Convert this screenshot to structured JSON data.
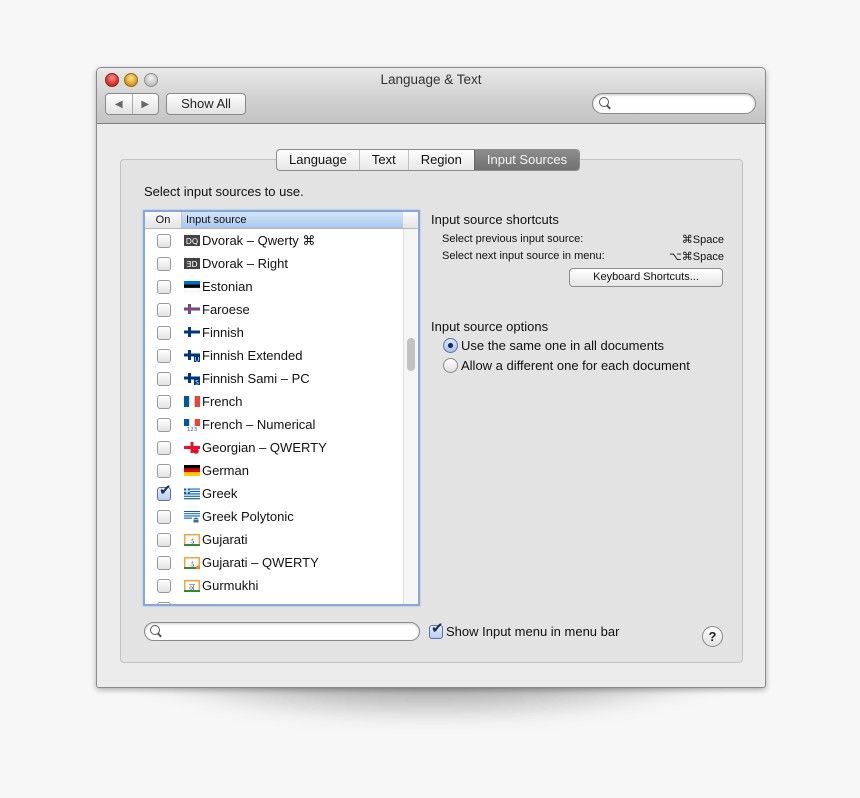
{
  "window": {
    "title": "Language & Text",
    "nav": {
      "back_icon": "◀",
      "forward_icon": "▶"
    },
    "show_all_label": "Show All",
    "search": {
      "value": "",
      "placeholder": ""
    }
  },
  "tabs": [
    {
      "label": "Language",
      "active": false
    },
    {
      "label": "Text",
      "active": false
    },
    {
      "label": "Region",
      "active": false
    },
    {
      "label": "Input Sources",
      "active": true
    }
  ],
  "input_sources": {
    "prompt": "Select input sources to use.",
    "columns": {
      "on": "On",
      "source": "Input source"
    },
    "rows": [
      {
        "label": "Dvorak – Qwerty ⌘",
        "icon": "dvorak-qwerty-icon",
        "checked": false
      },
      {
        "label": "Dvorak – Right",
        "icon": "dvorak-right-icon",
        "checked": false
      },
      {
        "label": "Estonian",
        "icon": "estonia-flag-icon",
        "checked": false
      },
      {
        "label": "Faroese",
        "icon": "faroe-flag-icon",
        "checked": false
      },
      {
        "label": "Finnish",
        "icon": "finland-flag-icon",
        "checked": false
      },
      {
        "label": "Finnish Extended",
        "icon": "finland-extended-flag-icon",
        "checked": false
      },
      {
        "label": "Finnish Sami – PC",
        "icon": "finland-sami-flag-icon",
        "checked": false
      },
      {
        "label": "French",
        "icon": "france-flag-icon",
        "checked": false
      },
      {
        "label": "French – Numerical",
        "icon": "france-numerical-flag-icon",
        "checked": false
      },
      {
        "label": "Georgian – QWERTY",
        "icon": "georgia-flag-icon",
        "checked": false
      },
      {
        "label": "German",
        "icon": "germany-flag-icon",
        "checked": false
      },
      {
        "label": "Greek",
        "icon": "greece-flag-icon",
        "checked": true
      },
      {
        "label": "Greek Polytonic",
        "icon": "greece-polytonic-flag-icon",
        "checked": false
      },
      {
        "label": "Gujarati",
        "icon": "gujarati-icon",
        "checked": false
      },
      {
        "label": "Gujarati – QWERTY",
        "icon": "gujarati-qwerty-icon",
        "checked": false
      },
      {
        "label": "Gurmukhi",
        "icon": "gurmukhi-icon",
        "checked": false
      }
    ],
    "search": {
      "value": "",
      "placeholder": ""
    }
  },
  "shortcuts": {
    "title": "Input source shortcuts",
    "items": [
      {
        "label": "Select previous input source:",
        "keys": "⌘Space"
      },
      {
        "label": "Select next input source in menu:",
        "keys": "⌥⌘Space"
      }
    ],
    "button_label": "Keyboard Shortcuts..."
  },
  "options": {
    "title": "Input source options",
    "radios": [
      {
        "label": "Use the same one in all documents",
        "selected": true
      },
      {
        "label": "Allow a different one for each document",
        "selected": false
      }
    ]
  },
  "show_input_menu": {
    "label": "Show Input menu in menu bar",
    "checked": true
  },
  "help_label": "?",
  "glyphs": {
    "check": "✔",
    "gujarati": "ડ",
    "gurmukhi": "ਕ"
  },
  "colors": {
    "selected_tab": "#7d7d7d",
    "list_focus": "#86a8d8",
    "header_selected": "#a8c7ee"
  }
}
